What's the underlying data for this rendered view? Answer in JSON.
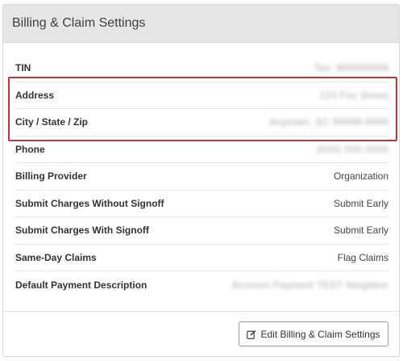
{
  "panel": {
    "title": "Billing & Claim Settings"
  },
  "settings": [
    {
      "label": "TIN",
      "value": "Tax: 999999999",
      "blurred": true
    },
    {
      "label": "Address",
      "value": "123 Fox Street",
      "blurred": true
    },
    {
      "label": "City / State / Zip",
      "value": "Anytown, SC 99999-9999",
      "blurred": true
    },
    {
      "label": "Phone",
      "value": "(555) 555-5555",
      "blurred": true
    },
    {
      "label": "Billing Provider",
      "value": "Organization",
      "blurred": false
    },
    {
      "label": "Submit Charges Without Signoff",
      "value": "Submit Early",
      "blurred": false
    },
    {
      "label": "Submit Charges With Signoff",
      "value": "Submit Early",
      "blurred": false
    },
    {
      "label": "Same-Day Claims",
      "value": "Flag Claims",
      "blurred": false
    },
    {
      "label": "Default Payment Description",
      "value": "Account Payment TEST Neighbor",
      "blurred": true
    }
  ],
  "footer": {
    "edit_button_label": "Edit Billing & Claim Settings",
    "edit_icon": "edit-pencil-icon"
  },
  "colors": {
    "highlight_border": "#b5393c",
    "header_bg": "#e6e6e6"
  }
}
